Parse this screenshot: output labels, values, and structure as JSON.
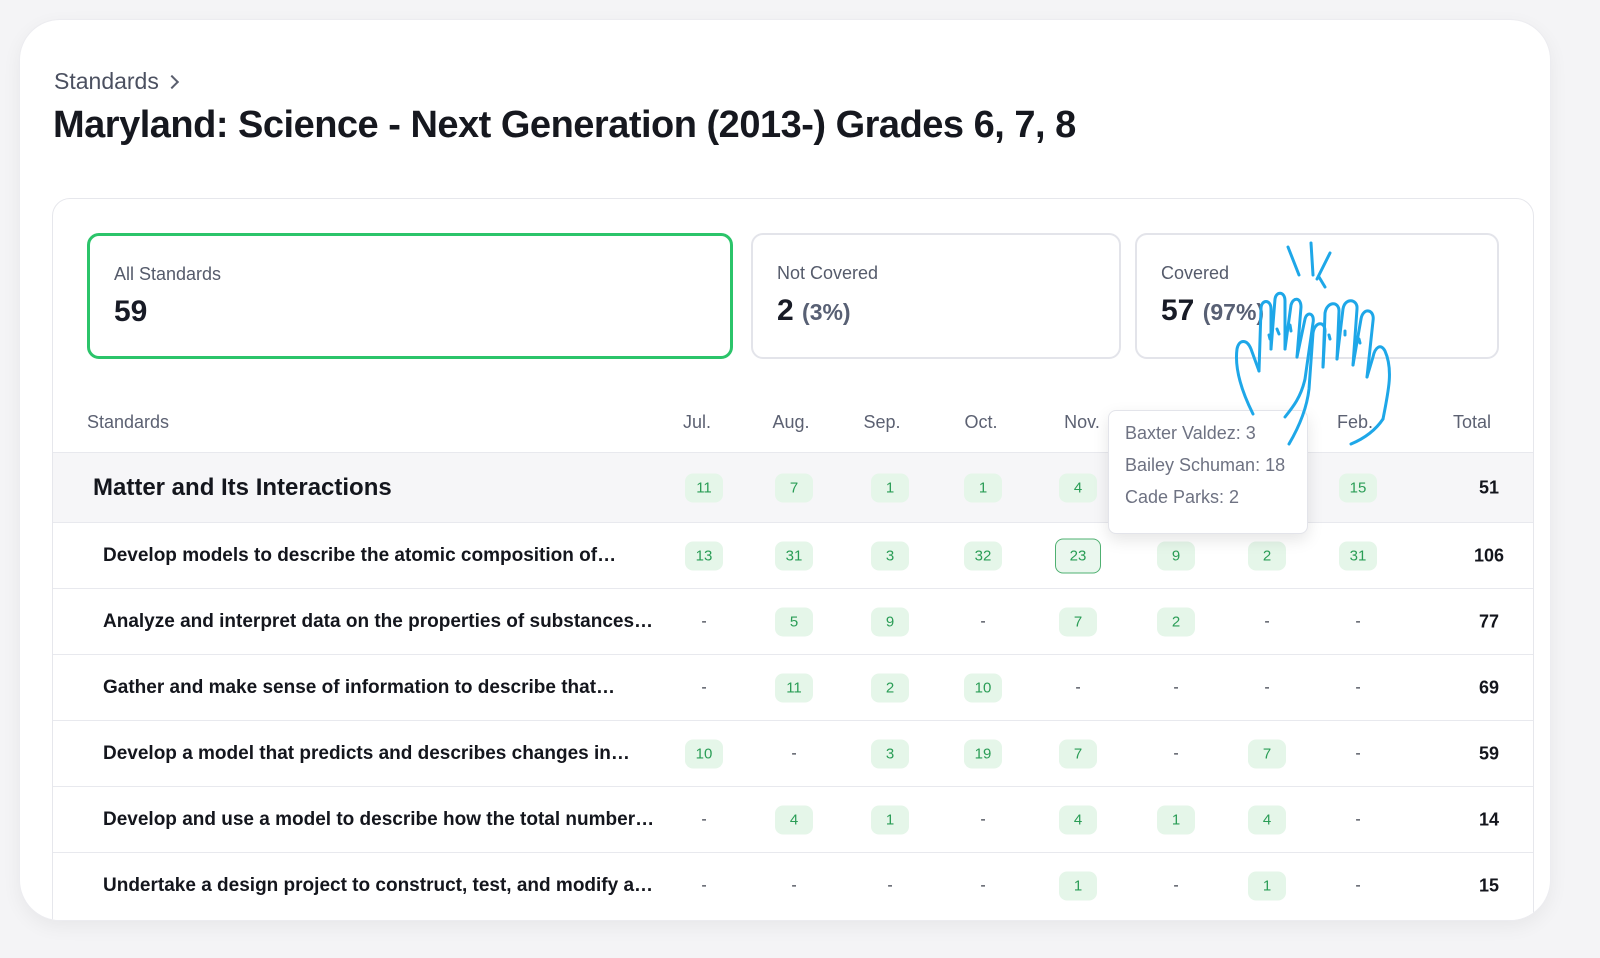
{
  "breadcrumb": {
    "label": "Standards"
  },
  "page_title": "Maryland: Science - Next Generation (2013-) Grades 6, 7, 8",
  "cards": [
    {
      "label": "All Standards",
      "value": "59",
      "pct": ""
    },
    {
      "label": "Not Covered",
      "value": "2",
      "pct": "(3%)"
    },
    {
      "label": "Covered",
      "value": "57",
      "pct": "(97%)"
    }
  ],
  "table": {
    "headers": {
      "standards": "Standards",
      "jul": "Jul.",
      "aug": "Aug.",
      "sep": "Sep.",
      "oct": "Oct.",
      "nov": "Nov.",
      "feb": "Feb.",
      "total": "Total"
    },
    "group": {
      "label": "Matter and Its Interactions",
      "cells": [
        "11",
        "7",
        "1",
        "1",
        "4",
        "",
        "",
        "15"
      ],
      "total": "51"
    },
    "rows": [
      {
        "label": "Develop models to describe the atomic composition of…",
        "cells": [
          "13",
          "31",
          "3",
          "32",
          "23",
          "9",
          "2",
          "31"
        ],
        "total": "106"
      },
      {
        "label": "Analyze and interpret data on the properties of substances…",
        "cells": [
          "-",
          "5",
          "9",
          "-",
          "7",
          "2",
          "-",
          "-"
        ],
        "total": "77"
      },
      {
        "label": "Gather and make sense of information to describe that…",
        "cells": [
          "-",
          "11",
          "2",
          "10",
          "-",
          "-",
          "-",
          "-"
        ],
        "total": "69"
      },
      {
        "label": "Develop a model that predicts and describes changes in…",
        "cells": [
          "10",
          "-",
          "3",
          "19",
          "7",
          "-",
          "7",
          "-"
        ],
        "total": "59"
      },
      {
        "label": "Develop and use a model to describe how the total number…",
        "cells": [
          "-",
          "4",
          "1",
          "-",
          "4",
          "1",
          "4",
          "-"
        ],
        "total": "14"
      },
      {
        "label": "Undertake a design project to construct, test, and modify a…",
        "cells": [
          "-",
          "-",
          "-",
          "-",
          "1",
          "-",
          "1",
          "-"
        ],
        "total": "15"
      }
    ]
  },
  "tooltip": {
    "lines": [
      "Baxter Valdez: 3",
      "Bailey Schuman: 18",
      "Cade Parks: 2"
    ]
  },
  "colors": {
    "accent": "#2bc46a",
    "chip_bg": "#e5f6e9",
    "chip_text": "#2a9d56",
    "illustration": "#1ea7e8"
  },
  "icons": {
    "breadcrumb": "chevron-right-icon",
    "illustration": "high-five-hands-icon"
  }
}
